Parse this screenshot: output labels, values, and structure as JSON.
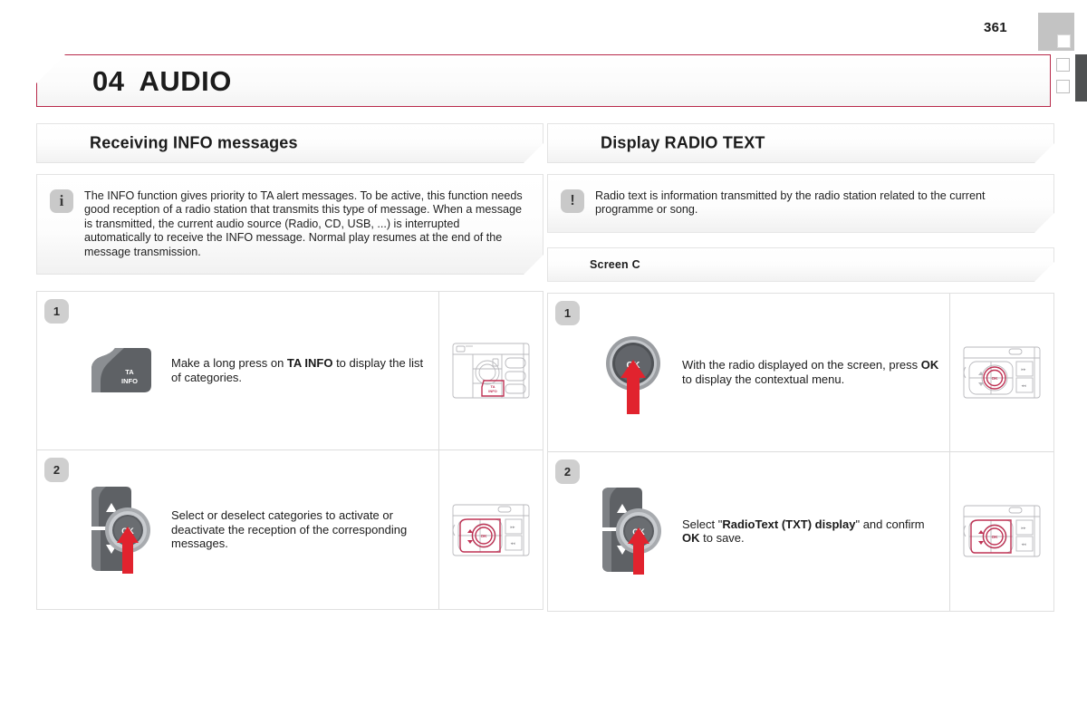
{
  "page": {
    "number": "361",
    "chapter_number": "04",
    "chapter_title": "AUDIO",
    "accent_color": "#b8294a",
    "arrow_color": "#e1232e",
    "badge_color": "#cfcfcf",
    "edge_tab_color": "#c3c3c3",
    "edge_bar_color": "#4f5152"
  },
  "left_column": {
    "heading": "Receiving INFO messages",
    "note": {
      "icon": "info-icon",
      "icon_glyph": "i",
      "text": "The INFO function gives priority to TA alert messages. To be active, this function needs good reception of a radio station that transmits this type of message. When a message is transmitted, the current audio source (Radio, CD, USB, ...) is interrupted automatically to receive the INFO message. Normal play resumes at the end of the message transmission."
    },
    "steps": [
      {
        "badge": "1",
        "artwork": "ta-info-button",
        "button_label_line1": "TA",
        "button_label_line2": "INFO",
        "text_parts": [
          {
            "t": "Make a long press on ",
            "b": false
          },
          {
            "t": "TA INFO",
            "b": true
          },
          {
            "t": " to display the list of categories.",
            "b": false
          }
        ],
        "thumbnail": "console-ta-info-highlighted"
      },
      {
        "badge": "2",
        "artwork": "ok-knob-with-arrows",
        "knob_label": "OK",
        "text_parts": [
          {
            "t": "Select or deselect categories to activate or deactivate the reception of the corresponding messages.",
            "b": false
          }
        ],
        "thumbnail": "console-arrows-ok-highlighted"
      }
    ]
  },
  "right_column": {
    "heading": "Display RADIO TEXT",
    "note": {
      "icon": "warning-icon",
      "icon_glyph": "!",
      "text": "Radio text is information transmitted by the radio station related to the current programme or song."
    },
    "subheading": "Screen C",
    "steps": [
      {
        "badge": "1",
        "artwork": "ok-knob",
        "knob_label": "OK",
        "text_parts": [
          {
            "t": "With the radio displayed on the screen, press ",
            "b": false
          },
          {
            "t": "OK",
            "b": true
          },
          {
            "t": " to display the contextual menu.",
            "b": false
          }
        ],
        "thumbnail": "console-ok-highlighted"
      },
      {
        "badge": "2",
        "artwork": "ok-knob-with-arrows",
        "knob_label": "OK",
        "text_parts": [
          {
            "t": "Select \"",
            "b": false
          },
          {
            "t": "RadioText (TXT) display",
            "b": true
          },
          {
            "t": "\" and confirm ",
            "b": false
          },
          {
            "t": "OK",
            "b": true
          },
          {
            "t": " to save.",
            "b": false
          }
        ],
        "thumbnail": "console-arrows-ok-highlighted"
      }
    ]
  }
}
